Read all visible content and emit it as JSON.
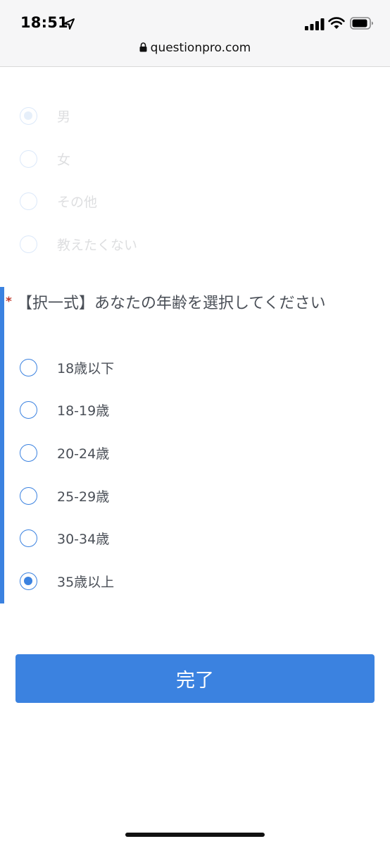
{
  "status_bar": {
    "time": "18:51",
    "icons": [
      "location-arrow-icon",
      "signal-icon",
      "wifi-icon",
      "battery-icon"
    ]
  },
  "browser": {
    "url": "questionpro.com",
    "icons": [
      "lock-icon"
    ]
  },
  "question1": {
    "options": [
      {
        "label": "男",
        "checked": true
      },
      {
        "label": "女",
        "checked": false
      },
      {
        "label": "その他",
        "checked": false
      },
      {
        "label": "教えたくない",
        "checked": false
      }
    ]
  },
  "question2": {
    "required_mark": "*",
    "title": "【択一式】あなたの年齢を選択してください",
    "options": [
      {
        "label": "18歳以下",
        "checked": false
      },
      {
        "label": "18-19歳",
        "checked": false
      },
      {
        "label": "20-24歳",
        "checked": false
      },
      {
        "label": "25-29歳",
        "checked": false
      },
      {
        "label": "30-34歳",
        "checked": false
      },
      {
        "label": "35歳以上",
        "checked": true
      }
    ]
  },
  "submit": {
    "label": "完了"
  },
  "colors": {
    "accent": "#3b82e0",
    "text": "#4a4f57",
    "required": "#c0392b"
  }
}
